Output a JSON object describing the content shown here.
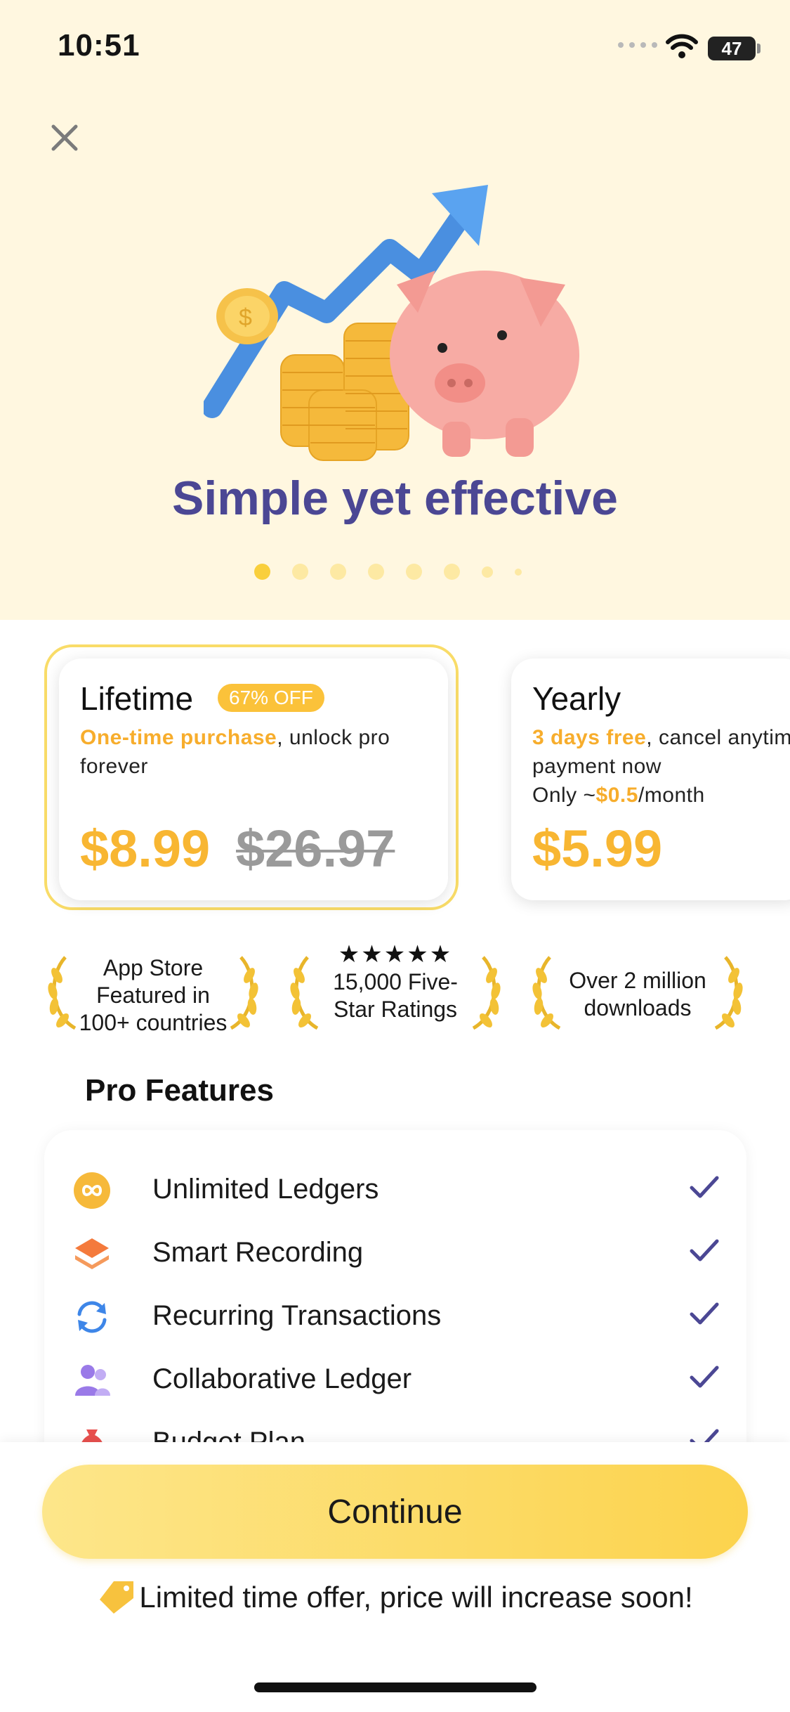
{
  "status_bar": {
    "time": "10:51",
    "battery": "47"
  },
  "hero": {
    "title": "Simple yet effective",
    "pager_count": 8,
    "active_page": 1
  },
  "plans": [
    {
      "name": "Lifetime",
      "badge": "67% OFF",
      "desc_highlight": "One-time purchase",
      "desc_rest": ", unlock pro forever",
      "price": "$8.99",
      "old_price": "$26.97",
      "selected": true
    },
    {
      "name": "Yearly",
      "desc_highlight": "3 days free",
      "desc_rest": ", cancel anytime,",
      "desc_line2": "payment now",
      "monthly_prefix": "Only ~",
      "monthly_value": "$0.5",
      "monthly_suffix": "/month",
      "price": "$5.99",
      "selected": false
    }
  ],
  "awards": [
    {
      "text": "App Store Featured in 100+ countries"
    },
    {
      "stars": "★★★★★",
      "text": "15,000 Five-Star Ratings"
    },
    {
      "text": "Over 2 million downloads"
    }
  ],
  "pro_features": {
    "title": "Pro Features",
    "items": [
      {
        "label": "Unlimited Ledgers",
        "icon": "infinity-icon"
      },
      {
        "label": "Smart Recording",
        "icon": "layers-icon"
      },
      {
        "label": "Recurring Transactions",
        "icon": "refresh-icon"
      },
      {
        "label": "Collaborative Ledger",
        "icon": "users-icon"
      },
      {
        "label": "Budget Plan",
        "icon": "money-bag-icon"
      }
    ]
  },
  "cta": {
    "label": "Continue"
  },
  "offer_note": "Limited time offer, price will increase soon!",
  "colors": {
    "accent": "#f8b632",
    "title": "#4b4794",
    "check": "#4b4794",
    "hero_bg": "#fff7e0"
  }
}
